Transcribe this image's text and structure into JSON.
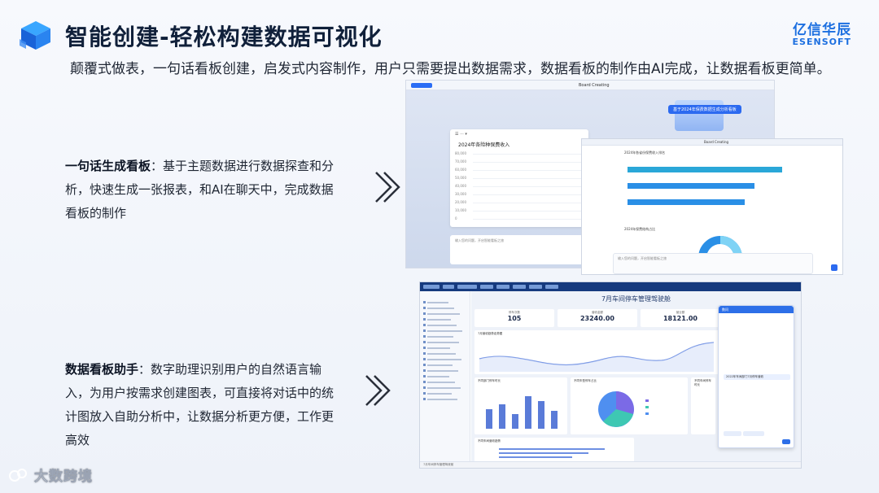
{
  "header": {
    "title": "智能创建-轻松构建数据可视化",
    "brand_cn": "亿信华辰",
    "brand_en": "ESENSOFT"
  },
  "intro": "颠覆式做表，一句话看板创建，启发式内容制作，用户只需要提出数据需求，数据看板的制作由AI完成，让数据看板更简单。",
  "features": [
    {
      "title": "一句话生成看板",
      "text": "：基于主题数据进行数据探查和分析，快速生成一张报表，和AI在聊天中，完成数据看板的制作"
    },
    {
      "title": "数据看板助手",
      "text": "：数字助理识别用户的自然语言输入，为用户按需求创建图表，可直接将对话中的统计图放入自助分析中，让数据分析更方便，工作更高效"
    }
  ],
  "shot1": {
    "window_title": "Board Creating",
    "card_title": "2024年各险种保费收入",
    "y_ticks": [
      "80,000",
      "70,000",
      "60,000",
      "50,000",
      "40,000",
      "30,000",
      "20,000",
      "10,000",
      "0"
    ],
    "input_placeholder": "输入您的问题，开启智能看板之旅",
    "ai_tag": "基于2024年保费数据生成分析看板"
  },
  "shot2": {
    "window_title": "Board Creating",
    "chart_title": "2024年各省份保费收入排名",
    "chart2_title": "2024年保费结构占比",
    "input_placeholder": "输入您的问题，开启智能看板之旅",
    "bar_values": [
      0.95,
      0.78,
      0.72
    ]
  },
  "shot3": {
    "dashboard_title": "7月车间停车管理驾驶舱",
    "kpis": [
      {
        "label": "停车次数",
        "value": "105"
      },
      {
        "label": "营收金额",
        "value": "23240.00"
      },
      {
        "label": "营业额",
        "value": "18121.00"
      }
    ],
    "panel_titles": [
      "7月营收趋势走势图",
      "不同部门停车时长",
      "不同车型停车占比",
      "不同车间停车时长",
      "不同车间营收趋势"
    ],
    "assistant_title": "数问",
    "assistant_q": "2022年车间部门7月停车营收",
    "footer": "7月车间停车管理驾驶舱"
  },
  "watermark": "大数跨境",
  "colors": {
    "accent": "#1c6fe0",
    "bar": "#2aa7d8",
    "pie1": "#7b6ae6",
    "pie2": "#3ec8b3",
    "pie3": "#4f8ff0"
  }
}
